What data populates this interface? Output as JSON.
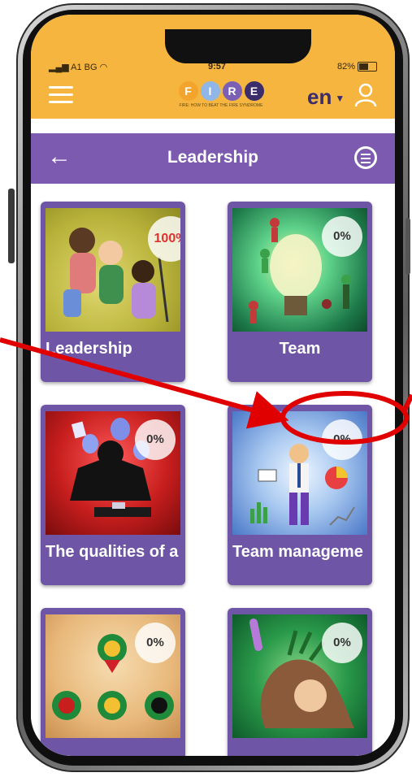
{
  "status_bar": {
    "carrier": "A1 BG",
    "time": "9:57",
    "battery": "82%"
  },
  "header": {
    "logo_letters": [
      "F",
      "I",
      "R",
      "E"
    ],
    "logo_subtitle": "FIRE: HOW TO BEAT THE FIRE SYNDROME",
    "language": "en"
  },
  "title_bar": {
    "title": "Leadership"
  },
  "cards": [
    {
      "label": "Leadership",
      "progress": "100%"
    },
    {
      "label": "Team",
      "progress": "0%"
    },
    {
      "label": "The qualities of a",
      "progress": "0%"
    },
    {
      "label": "Team manageme",
      "progress": "0%"
    },
    {
      "label": "",
      "progress": "0%"
    },
    {
      "label": "",
      "progress": "0%"
    }
  ],
  "colors": {
    "header": "#f6b53f",
    "title_bar": "#7c5ab0",
    "card": "#6f55a6",
    "annotation": "#e00000"
  }
}
